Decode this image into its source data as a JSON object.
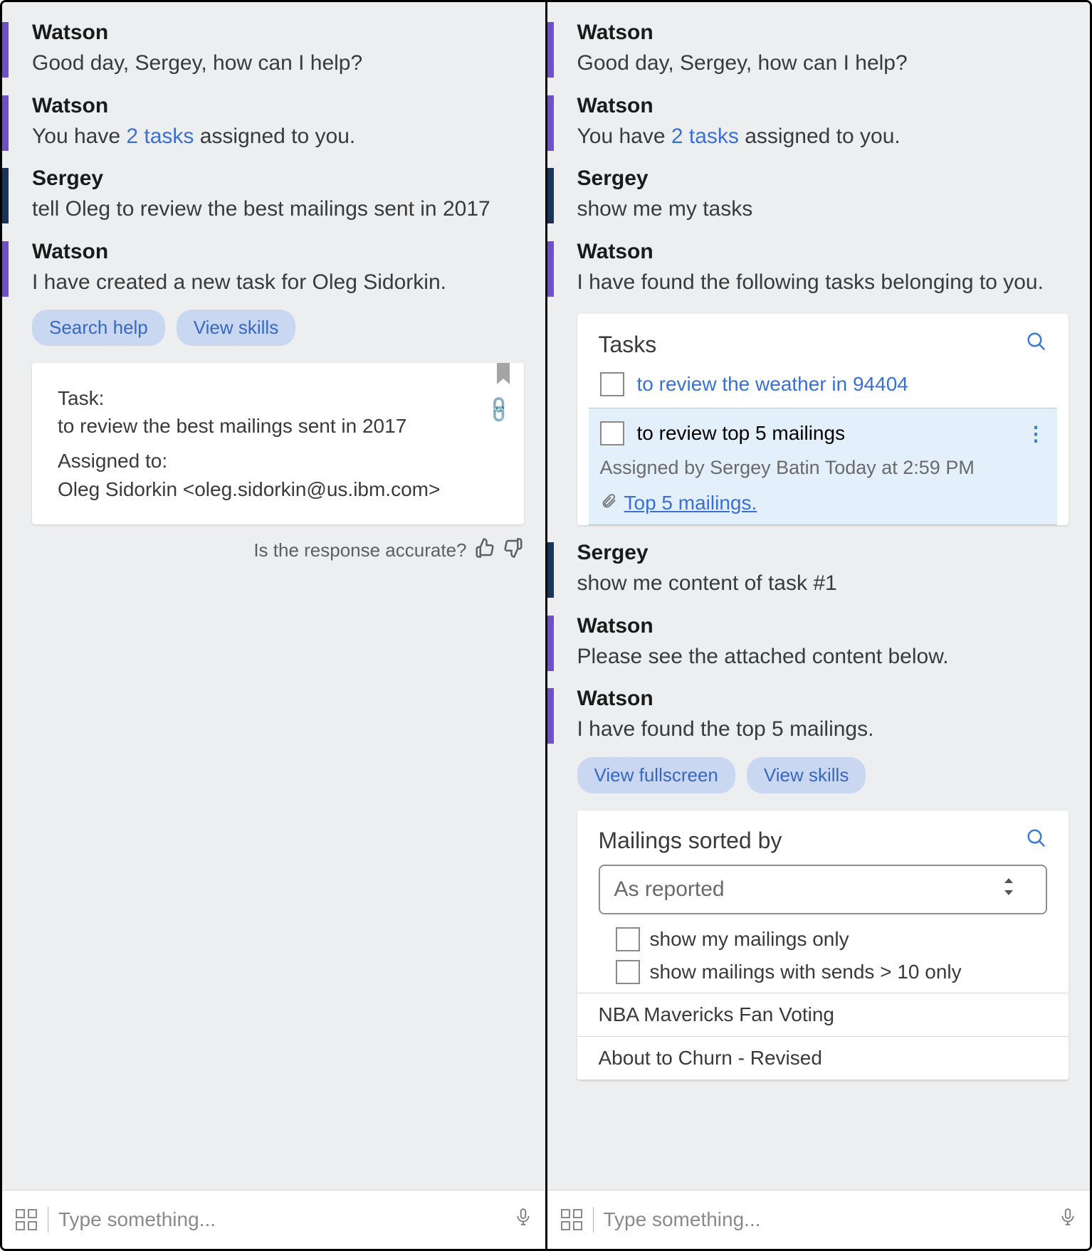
{
  "input": {
    "placeholder": "Type something..."
  },
  "left": {
    "messages": [
      {
        "sender": "Watson",
        "type": "bot",
        "text": "Good day, Sergey, how can I help?"
      },
      {
        "sender": "Watson",
        "type": "bot",
        "prefix": "You have ",
        "link": "2 tasks",
        "suffix": " assigned to you."
      },
      {
        "sender": "Sergey",
        "type": "user",
        "text": "tell Oleg to review the best mailings sent in 2017"
      },
      {
        "sender": "Watson",
        "type": "bot",
        "text": "I have created a new task for Oleg Sidorkin.",
        "chips": [
          "Search help",
          "View skills"
        ]
      }
    ],
    "task_card": {
      "label_task": "Task:",
      "task_text": "to review the best mailings sent in 2017",
      "label_assigned": "Assigned to:",
      "assigned_text": "Oleg Sidorkin <oleg.sidorkin@us.ibm.com>"
    },
    "feedback": {
      "prompt": "Is the response accurate?"
    }
  },
  "right": {
    "messages_top": [
      {
        "sender": "Watson",
        "type": "bot",
        "text": "Good day, Sergey, how can I help?"
      },
      {
        "sender": "Watson",
        "type": "bot",
        "prefix": "You have ",
        "link": "2 tasks",
        "suffix": " assigned to you."
      },
      {
        "sender": "Sergey",
        "type": "user",
        "text": "show me my tasks"
      },
      {
        "sender": "Watson",
        "type": "bot",
        "text": "I have found the following tasks belonging to you."
      }
    ],
    "tasks_card": {
      "title": "Tasks",
      "items": [
        {
          "title": "to review the weather in 94404"
        },
        {
          "title": "to review top 5 mailings",
          "assigned": "Assigned by Sergey Batin Today at 2:59 PM",
          "attachment": "Top 5 mailings."
        }
      ]
    },
    "messages_mid": [
      {
        "sender": "Sergey",
        "type": "user",
        "text": "show me content of task #1"
      },
      {
        "sender": "Watson",
        "type": "bot",
        "text": "Please see the attached content below."
      },
      {
        "sender": "Watson",
        "type": "bot",
        "text": "I have found the top 5 mailings.",
        "chips": [
          "View fullscreen",
          "View skills"
        ]
      }
    ],
    "mailings_card": {
      "title": "Mailings sorted by",
      "select": "As reported",
      "filters": [
        "show my mailings only",
        "show mailings with sends > 10 only"
      ],
      "items": [
        "NBA Mavericks Fan Voting",
        "About to Churn - Revised"
      ]
    }
  }
}
